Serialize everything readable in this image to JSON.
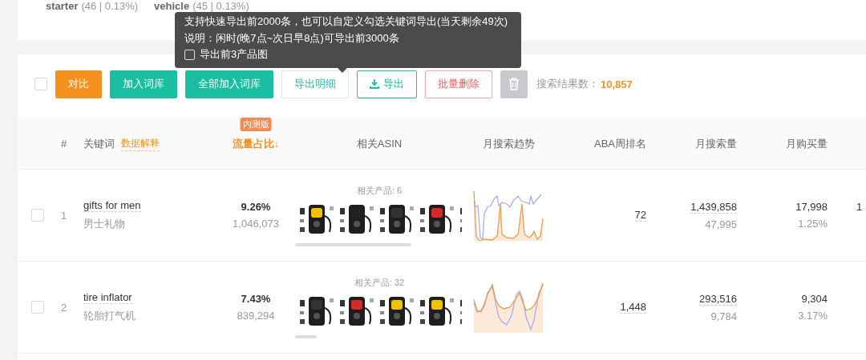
{
  "top_tags": [
    {
      "term": "starter",
      "stats": "(46 | 0.13%)"
    },
    {
      "term": "vehicle",
      "stats": "(45 | 0.13%)"
    }
  ],
  "tooltip": {
    "lines": [
      "支持快速导出前2000条，也可以自定义勾选关键词导出(当天剩余49次)",
      "说明：闲时(晚7点~次日早8点)可导出前3000条"
    ],
    "option": {
      "label": "导出前3产品图",
      "checked": false
    }
  },
  "toolbar": {
    "select_all": {
      "checked": false
    },
    "buttons": [
      {
        "label": "对比",
        "kind": "orange"
      },
      {
        "label": "加入词库",
        "kind": "teal"
      },
      {
        "label": "全部加入词库",
        "kind": "teal"
      },
      {
        "label": "导出明细",
        "kind": "outline"
      },
      {
        "label": "导出",
        "kind": "export"
      },
      {
        "label": "批量删除",
        "kind": "danger"
      },
      {
        "kind": "trash"
      }
    ],
    "result_label": "搜索结果数：",
    "result_count": "10,857"
  },
  "table": {
    "columns": [
      {
        "label": "#"
      },
      {
        "label": "关键词",
        "link": "数据解释"
      },
      {
        "label": "流量占比↓",
        "badge": "内测版",
        "sorted": true
      },
      {
        "label": "相关ASIN"
      },
      {
        "label": "月搜索趋势"
      },
      {
        "label": "ABA周排名"
      },
      {
        "label": "月搜索量"
      },
      {
        "label": "月购买量"
      }
    ],
    "rows": [
      {
        "index": "1",
        "checked": false,
        "keyword": "gifts for men",
        "translation": "男士礼物",
        "traffic_share": "9.26%",
        "traffic_count": "1,046,073",
        "related_label": "相关产品: 6",
        "aba_rank": "72",
        "monthly_search": "1,439,858",
        "daily_search": "47,995",
        "monthly_purchase": "17,998",
        "purchase_rate": "1.25%",
        "column_9": "1"
      },
      {
        "index": "2",
        "checked": false,
        "keyword": "tire inflator",
        "translation": "轮胎打气机",
        "traffic_share": "7.43%",
        "traffic_count": "839,294",
        "related_label": "相关产品: 32",
        "aba_rank": "1,448",
        "monthly_search": "293,516",
        "daily_search": "9,784",
        "monthly_purchase": "9,304",
        "purchase_rate": "3.17%"
      }
    ]
  }
}
